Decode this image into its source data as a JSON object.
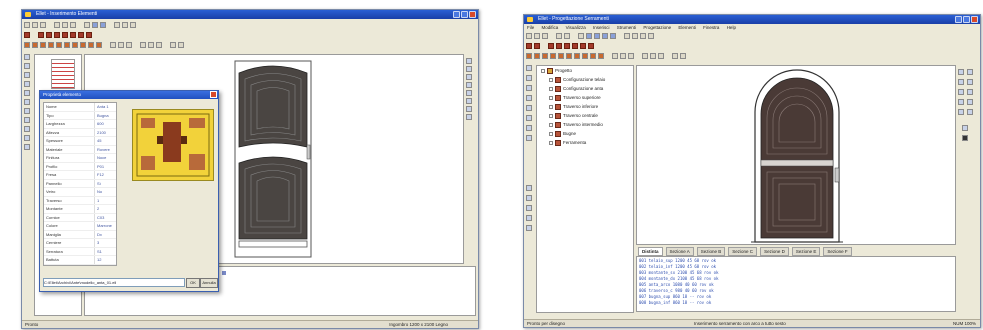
{
  "left_window": {
    "title": "Ellet - Inserimento Elementi",
    "status_text": "Pronto",
    "right_status": "Ingombro   1200 x 2100   Legno",
    "dialog": {
      "title": "Proprietà elemento",
      "path_value": "C:\\Ellet\\Archivi\\Ante\\modello_anta_01.ell",
      "ok_label": "OK",
      "cancel_label": "Annulla",
      "properties": [
        {
          "k": "Nome",
          "v": "Anta 1"
        },
        {
          "k": "Tipo",
          "v": "Bugna"
        },
        {
          "k": "Larghezza",
          "v": "600"
        },
        {
          "k": "Altezza",
          "v": "2100"
        },
        {
          "k": "Spessore",
          "v": "45"
        },
        {
          "k": "Materiale",
          "v": "Rovere"
        },
        {
          "k": "Finitura",
          "v": "Noce"
        },
        {
          "k": "Profilo",
          "v": "P01"
        },
        {
          "k": "Fresa",
          "v": "F12"
        },
        {
          "k": "Pannello",
          "v": "Sì"
        },
        {
          "k": "Vetro",
          "v": "No"
        },
        {
          "k": "Traverso",
          "v": "1"
        },
        {
          "k": "Montante",
          "v": "2"
        },
        {
          "k": "Cornice",
          "v": "C03"
        },
        {
          "k": "Colore",
          "v": "Marrone"
        },
        {
          "k": "Maniglia",
          "v": "Dx"
        },
        {
          "k": "Cerniere",
          "v": "3"
        },
        {
          "k": "Serratura",
          "v": "S1"
        },
        {
          "k": "Battuta",
          "v": "12"
        },
        {
          "k": "Quote",
          "v": "Auto"
        },
        {
          "k": "Note",
          "v": ""
        }
      ]
    }
  },
  "right_window": {
    "title": "Ellet - Progettazione Serramenti",
    "menu": [
      "File",
      "Modifica",
      "Visualizza",
      "Inserisci",
      "Strumenti",
      "Progettazione",
      "Elementi",
      "Finestra",
      "Help"
    ],
    "tree_root": "Progetto",
    "tree_items": [
      "Configurazione telaio",
      "Configurazione anta",
      "Traverso superiore",
      "Traverso inferiore",
      "Traverso centrale",
      "Traverso intermedio",
      "Bugne",
      "Ferramenta"
    ],
    "tabs": [
      "Distinta",
      "Sezione A",
      "Sezione B",
      "Sezione C",
      "Sezione D",
      "Sezione E",
      "Sezione F"
    ],
    "code_lines": [
      "001 telaio_sup   1200  45  68   rov   ok",
      "002 telaio_inf   1200  45  68   rov   ok",
      "003 montante_sx  2100  45  68   rov   ok",
      "004 montante_dx  2100  45  68   rov   ok",
      "005 anta_arco    1080  40  60   rov   ok",
      "006 traverso_c    980  40  60   rov   ok",
      "007 bugna_sup     860  18  --   rov   ok",
      "008 bugna_inf     860  18  --   rov   ok"
    ],
    "status_left": "Pronto per disegno",
    "status_mid": "Inserimento serramento con arco a tutto sesto",
    "status_right": "NUM   100%"
  },
  "colors": {
    "title_bar": "#1a3fa8",
    "door_wood": "#4a3a36",
    "dialog_preview": "#f2d23a",
    "code_text": "#3050b0"
  }
}
